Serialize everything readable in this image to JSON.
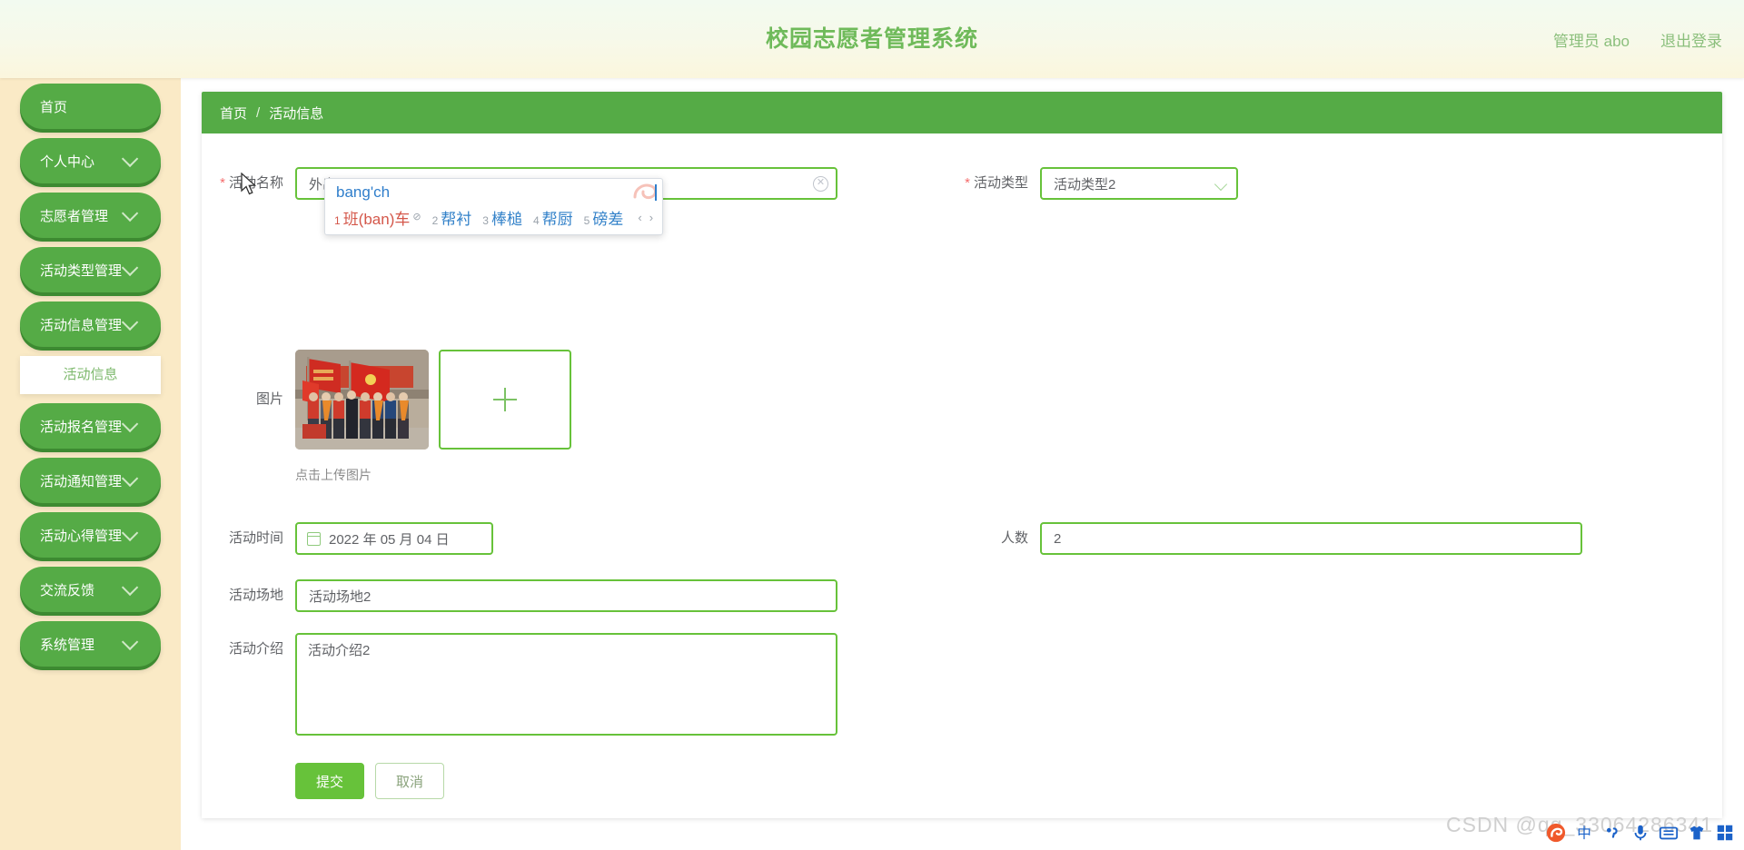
{
  "header": {
    "title": "校园志愿者管理系统",
    "admin_label": "管理员 abo",
    "logout_label": "退出登录"
  },
  "sidebar": {
    "items": [
      {
        "label": "首页",
        "has_chevron": false
      },
      {
        "label": "个人中心",
        "has_chevron": true
      },
      {
        "label": "志愿者管理",
        "has_chevron": true
      },
      {
        "label": "活动类型管理",
        "has_chevron": true
      },
      {
        "label": "活动信息管理",
        "has_chevron": true
      },
      {
        "label": "活动报名管理",
        "has_chevron": true
      },
      {
        "label": "活动通知管理",
        "has_chevron": true
      },
      {
        "label": "活动心得管理",
        "has_chevron": true
      },
      {
        "label": "交流反馈",
        "has_chevron": true
      },
      {
        "label": "系统管理",
        "has_chevron": true
      }
    ],
    "submenu_item": "活动信息"
  },
  "breadcrumb": {
    "home": "首页",
    "separator": "/",
    "current": "活动信息"
  },
  "form": {
    "activity_name": {
      "label": "活动名称",
      "required_mark": "*",
      "value": "外出bangch",
      "clear_icon": "circle-close-icon"
    },
    "activity_type": {
      "label": "活动类型",
      "required_mark": "*",
      "value": "活动类型2",
      "chevron_icon": "chevron-down-icon"
    },
    "picture": {
      "label": "图片",
      "add_icon": "plus-icon",
      "hint": "点击上传图片"
    },
    "activity_time": {
      "label": "活动时间",
      "value": "2022 年 05 月 04 日",
      "calendar_icon": "calendar-icon"
    },
    "people_count": {
      "label": "人数",
      "value": "2"
    },
    "activity_place": {
      "label": "活动场地",
      "value": "活动场地2"
    },
    "activity_intro": {
      "label": "活动介绍",
      "value": "活动介绍2"
    },
    "submit_label": "提交",
    "cancel_label": "取消"
  },
  "ime": {
    "pinyin": "bang'ch",
    "candidates": [
      {
        "num": "1",
        "word": "班(ban)车",
        "mark": "⊘"
      },
      {
        "num": "2",
        "word": "帮衬",
        "mark": ""
      },
      {
        "num": "3",
        "word": "棒槌",
        "mark": ""
      },
      {
        "num": "4",
        "word": "帮厨",
        "mark": ""
      },
      {
        "num": "5",
        "word": "磅差",
        "mark": ""
      }
    ],
    "prev_arrow": "‹",
    "next_arrow": "›"
  },
  "watermark": {
    "text": "CSDN @qq_33064286341"
  },
  "tray": {
    "icons": [
      "sogou-logo-icon",
      "chinese-mode-icon",
      "punctuation-icon",
      "microphone-icon",
      "keyboard-icon",
      "skin-icon",
      "toolbox-icon"
    ]
  },
  "colors": {
    "brand_green": "#55ab46",
    "input_green": "#67c23a",
    "sidebar_cream": "#faeac6",
    "header_cream": "#fbf6dd"
  }
}
